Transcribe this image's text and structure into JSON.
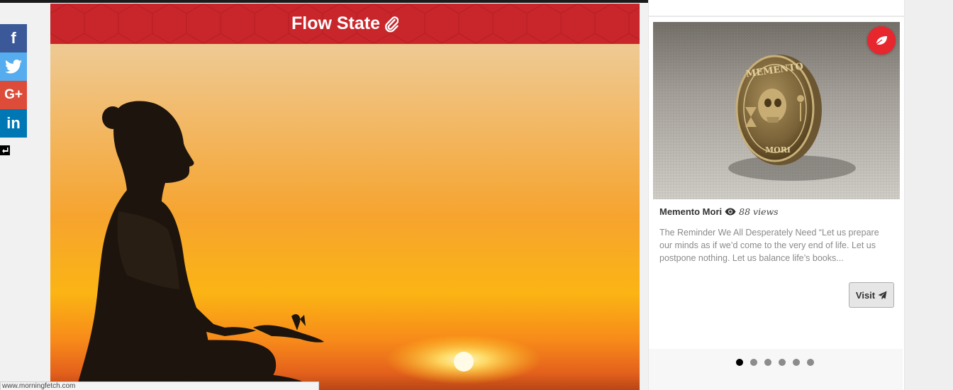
{
  "article": {
    "title": "Flow State"
  },
  "social": {
    "facebook": "f",
    "googleplus": "G+",
    "linkedin": "in",
    "icons": [
      "facebook-icon",
      "twitter-icon",
      "googleplus-icon",
      "linkedin-icon",
      "collapse-arrow-icon"
    ]
  },
  "sidebar": {
    "item": {
      "title": "Memento Mori",
      "views": "88 views",
      "description": "The Reminder We All Desperately Need “Let us prepare our minds as if we’d come to the very end of life. Let us postpone nothing. Let us balance life’s books...",
      "visit_label": "Visit",
      "image_caption": "MEMENTO MORI"
    },
    "carousel": {
      "total": 6,
      "active_index": 0
    }
  },
  "status_bar": {
    "url": "www.morningfetch.com"
  },
  "colors": {
    "brand_red": "#c8262b",
    "facebook": "#3b5998",
    "twitter": "#55acee",
    "googleplus": "#dd4b39",
    "linkedin": "#0077b5"
  }
}
